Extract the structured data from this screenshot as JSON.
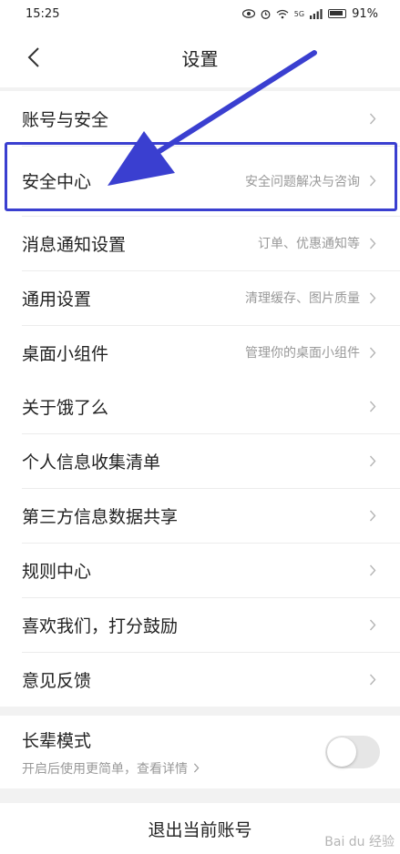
{
  "status_bar": {
    "time": "15:25",
    "network_label": "5G",
    "battery": "91%"
  },
  "header": {
    "title": "设置",
    "back_icon": "chevron-left-icon"
  },
  "section1": [
    {
      "label": "账号与安全",
      "desc": ""
    },
    {
      "label": "安全中心",
      "desc": "安全问题解决与咨询"
    },
    {
      "label": "消息通知设置",
      "desc": "订单、优惠通知等"
    },
    {
      "label": "通用设置",
      "desc": "清理缓存、图片质量"
    },
    {
      "label": "桌面小组件",
      "desc": "管理你的桌面小组件"
    }
  ],
  "section2": [
    {
      "label": "关于饿了么"
    },
    {
      "label": "个人信息收集清单"
    },
    {
      "label": "第三方信息数据共享"
    },
    {
      "label": "规则中心"
    },
    {
      "label": "喜欢我们，打分鼓励"
    },
    {
      "label": "意见反馈"
    }
  ],
  "elder_mode": {
    "title": "长辈模式",
    "subtitle": "开启后使用更简单，查看详情",
    "enabled": false
  },
  "logout": {
    "label": "退出当前账号"
  },
  "annotation": {
    "color": "#3a3fd0"
  },
  "watermark": "Bai du 经验"
}
